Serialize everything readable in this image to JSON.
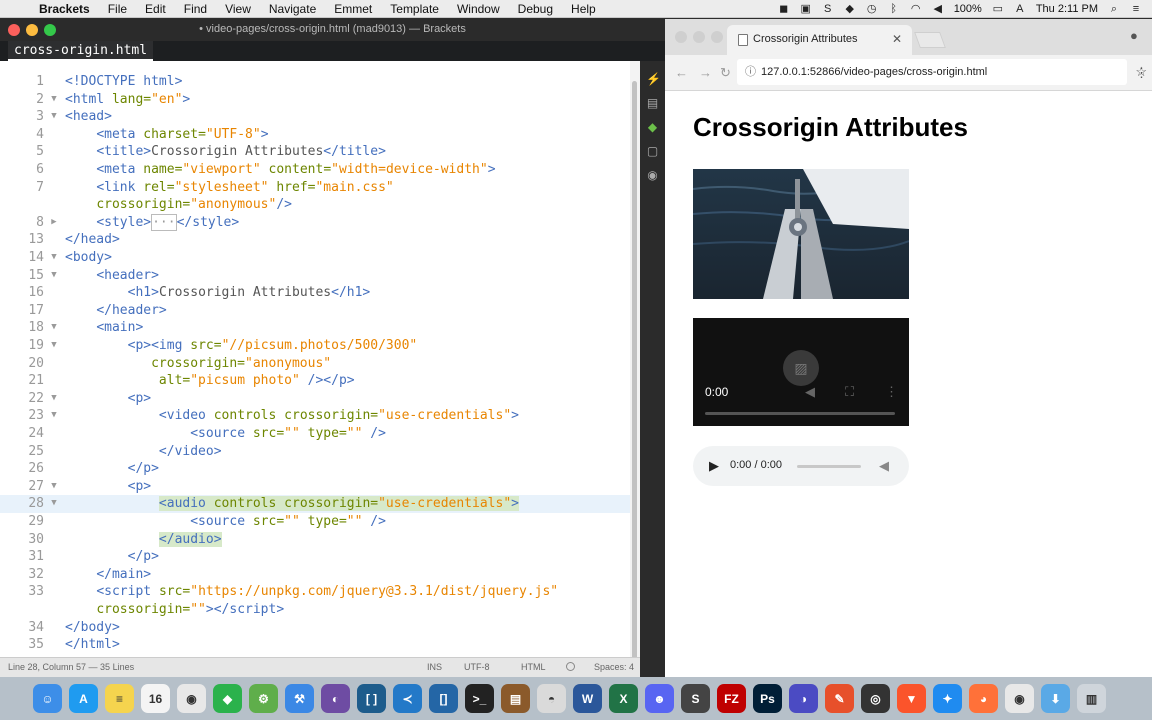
{
  "menubar": {
    "app_name": "Brackets",
    "menus": [
      "File",
      "Edit",
      "Find",
      "View",
      "Navigate",
      "Emmet",
      "Template",
      "Window",
      "Debug",
      "Help"
    ],
    "battery": "100%",
    "clock": "Thu 2:11 PM"
  },
  "brackets": {
    "window_title": "• video-pages/cross-origin.html (mad9013) — Brackets",
    "tab_label": "cross-origin.html",
    "lines": [
      {
        "n": "1",
        "html": "<span class=\"tag\">&lt;!DOCTYPE html&gt;</span>"
      },
      {
        "n": "2",
        "fold": "▼",
        "html": "<span class=\"tag\">&lt;html</span> <span class=\"attr\">lang=</span><span class=\"val\">\"en\"</span><span class=\"tag\">&gt;</span>"
      },
      {
        "n": "3",
        "fold": "▼",
        "html": "<span class=\"tag\">&lt;head&gt;</span>"
      },
      {
        "n": "4",
        "html": "    <span class=\"tag\">&lt;meta</span> <span class=\"attr\">charset=</span><span class=\"val\">\"UTF-8\"</span><span class=\"tag\">&gt;</span>"
      },
      {
        "n": "5",
        "html": "    <span class=\"tag\">&lt;title&gt;</span>Crossorigin Attributes<span class=\"tag\">&lt;/title&gt;</span>"
      },
      {
        "n": "6",
        "html": "    <span class=\"tag\">&lt;meta</span> <span class=\"attr\">name=</span><span class=\"val\">\"viewport\"</span> <span class=\"attr\">content=</span><span class=\"val\">\"width=device-width\"</span><span class=\"tag\">&gt;</span>"
      },
      {
        "n": "7",
        "html": "    <span class=\"tag\">&lt;link</span> <span class=\"attr\">rel=</span><span class=\"val\">\"stylesheet\"</span> <span class=\"attr\">href=</span><span class=\"val\">\"main.css\"</span>"
      },
      {
        "n": "",
        "html": "    <span class=\"attr\">crossorigin=</span><span class=\"val\">\"anonymous\"</span><span class=\"tag\">/&gt;</span>"
      },
      {
        "n": "8",
        "fold": "▶",
        "html": "    <span class=\"tag\">&lt;style&gt;</span><span style=\"border:1px solid #bbb;color:#999\">···</span><span class=\"tag\">&lt;/style&gt;</span>"
      },
      {
        "n": "13",
        "html": "<span class=\"tag\">&lt;/head&gt;</span>"
      },
      {
        "n": "14",
        "fold": "▼",
        "html": "<span class=\"tag\">&lt;body&gt;</span>"
      },
      {
        "n": "15",
        "fold": "▼",
        "html": "    <span class=\"tag\">&lt;header&gt;</span>"
      },
      {
        "n": "16",
        "html": "        <span class=\"tag\">&lt;h1&gt;</span>Crossorigin Attributes<span class=\"tag\">&lt;/h1&gt;</span>"
      },
      {
        "n": "17",
        "html": "    <span class=\"tag\">&lt;/header&gt;</span>"
      },
      {
        "n": "18",
        "fold": "▼",
        "html": "    <span class=\"tag\">&lt;main&gt;</span>"
      },
      {
        "n": "19",
        "fold": "▼",
        "html": "        <span class=\"tag\">&lt;p&gt;&lt;img</span> <span class=\"attr\">src=</span><span class=\"val\">\"//picsum.photos/500/300\"</span>"
      },
      {
        "n": "20",
        "html": "           <span class=\"attr\">crossorigin=</span><span class=\"val\">\"anonymous\"</span>"
      },
      {
        "n": "21",
        "html": "            <span class=\"attr\">alt=</span><span class=\"val\">\"picsum photo\"</span> <span class=\"tag\">/&gt;&lt;/p&gt;</span>"
      },
      {
        "n": "22",
        "fold": "▼",
        "html": "        <span class=\"tag\">&lt;p&gt;</span>"
      },
      {
        "n": "23",
        "fold": "▼",
        "html": "            <span class=\"tag\">&lt;video</span> <span class=\"attr\">controls</span> <span class=\"attr\">crossorigin=</span><span class=\"val\">\"use-credentials\"</span><span class=\"tag\">&gt;</span>"
      },
      {
        "n": "24",
        "html": "                <span class=\"tag\">&lt;source</span> <span class=\"attr\">src=</span><span class=\"val\">\"\"</span> <span class=\"attr\">type=</span><span class=\"val\">\"\"</span> <span class=\"tag\">/&gt;</span>"
      },
      {
        "n": "25",
        "html": "            <span class=\"tag\">&lt;/video&gt;</span>"
      },
      {
        "n": "26",
        "html": "        <span class=\"tag\">&lt;/p&gt;</span>"
      },
      {
        "n": "27",
        "fold": "▼",
        "html": "        <span class=\"tag\">&lt;p&gt;</span>"
      },
      {
        "n": "28",
        "fold": "▼",
        "active": true,
        "html": "            <span class=\"hl\"><span class=\"tag\">&lt;audio</span> <span class=\"attr\">controls</span> <span class=\"attr\">crossorigin=</span><span class=\"val\">\"use-credentials\"</span><span class=\"tag\">&gt;</span></span>"
      },
      {
        "n": "29",
        "html": "                <span class=\"tag\">&lt;source</span> <span class=\"attr\">src=</span><span class=\"val\">\"\"</span> <span class=\"attr\">type=</span><span class=\"val\">\"\"</span> <span class=\"tag\">/&gt;</span>"
      },
      {
        "n": "30",
        "html": "            <span class=\"hl\"><span class=\"tag\">&lt;/audio&gt;</span></span>"
      },
      {
        "n": "31",
        "html": "        <span class=\"tag\">&lt;/p&gt;</span>"
      },
      {
        "n": "32",
        "html": "    <span class=\"tag\">&lt;/main&gt;</span>"
      },
      {
        "n": "33",
        "html": "    <span class=\"tag\">&lt;script</span> <span class=\"attr\">src=</span><span class=\"val\">\"https://unpkg.com/jquery@3.3.1/dist/jquery.js\"</span>"
      },
      {
        "n": "",
        "html": "    <span class=\"attr\">crossorigin=</span><span class=\"val\">\"\"</span><span class=\"tag\">&gt;&lt;/script&gt;</span>"
      },
      {
        "n": "34",
        "html": "<span class=\"tag\">&lt;/body&gt;</span>"
      },
      {
        "n": "35",
        "html": "<span class=\"tag\">&lt;/html&gt;</span>"
      }
    ],
    "status": {
      "cursor": "Line 28, Column 57 — 35 Lines",
      "mode": "INS",
      "encoding": "UTF-8",
      "language": "HTML",
      "spaces": "Spaces: 4"
    }
  },
  "chrome": {
    "tab_title": "Crossorigin Attributes",
    "url": "127.0.0.1:52866/video-pages/cross-origin.html",
    "page": {
      "h1": "Crossorigin Attributes",
      "video_time": "0:00",
      "audio_time": "0:00 / 0:00"
    }
  },
  "dock": {
    "apps": [
      {
        "name": "finder",
        "label": "☺",
        "color": "#3d8ee8"
      },
      {
        "name": "app-store",
        "label": "A",
        "color": "#1f9bf0"
      },
      {
        "name": "notes",
        "label": "≡",
        "color": "#f5d44e"
      },
      {
        "name": "calendar",
        "label": "16",
        "color": "#f4f4f4"
      },
      {
        "name": "chrome",
        "label": "◉",
        "color": "#e8e8e8"
      },
      {
        "name": "sourcetree",
        "label": "◆",
        "color": "#2bb24c"
      },
      {
        "name": "chrome-dev",
        "label": "⚙",
        "color": "#5fae4b"
      },
      {
        "name": "xcode",
        "label": "⚒",
        "color": "#3b88e5"
      },
      {
        "name": "github-desktop",
        "label": "◐",
        "color": "#6e4ca3"
      },
      {
        "name": "brackets-dock",
        "label": "[ ]",
        "color": "#1d5c8c"
      },
      {
        "name": "vscode",
        "label": "≺",
        "color": "#2379c8"
      },
      {
        "name": "brackets",
        "label": "[]",
        "color": "#2466a6"
      },
      {
        "name": "terminal",
        "label": ">_",
        "color": "#222222"
      },
      {
        "name": "books",
        "label": "▤",
        "color": "#8b5a2b"
      },
      {
        "name": "elephant",
        "label": "◓",
        "color": "#dadada"
      },
      {
        "name": "word",
        "label": "W",
        "color": "#2b579a"
      },
      {
        "name": "excel",
        "label": "X",
        "color": "#217346"
      },
      {
        "name": "discord",
        "label": "☻",
        "color": "#5865f2"
      },
      {
        "name": "sublime",
        "label": "S",
        "color": "#444444"
      },
      {
        "name": "filezilla",
        "label": "FZ",
        "color": "#bf0000"
      },
      {
        "name": "photoshop",
        "label": "Ps",
        "color": "#001e36"
      },
      {
        "name": "firefox-dev",
        "label": "◑",
        "color": "#4b4bc3"
      },
      {
        "name": "pen-tool",
        "label": "✎",
        "color": "#e7502b"
      },
      {
        "name": "obs",
        "label": "◎",
        "color": "#333333"
      },
      {
        "name": "brave",
        "label": "▼",
        "color": "#fb542b"
      },
      {
        "name": "safari",
        "label": "✦",
        "color": "#1f8bf0"
      },
      {
        "name": "firefox",
        "label": "◕",
        "color": "#ff7139"
      },
      {
        "name": "chrome-canary",
        "label": "◉",
        "color": "#e8e8e8"
      },
      {
        "name": "downloads",
        "label": "⬇",
        "color": "#5aa9e6"
      },
      {
        "name": "trash",
        "label": "▥",
        "color": "#cfd5db"
      }
    ]
  }
}
